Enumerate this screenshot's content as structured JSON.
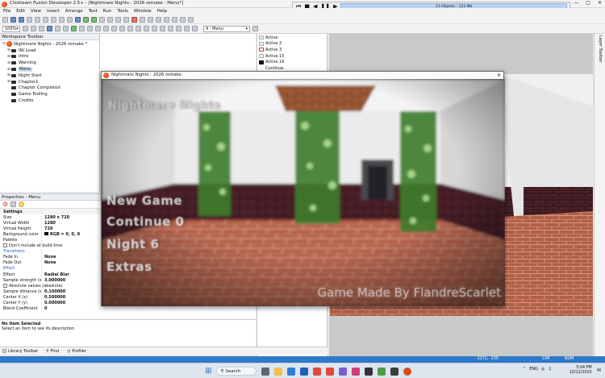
{
  "app": {
    "title": "Clickteam Fusion Developer 2.5+ - [Nightmare Nights - 2026 remake - Menu*]",
    "menus": [
      "File",
      "Edit",
      "View",
      "Insert",
      "Arrange",
      "Text",
      "Run",
      "Tools",
      "Window",
      "Help"
    ],
    "zoom": "100%",
    "frame_select": "4 - Menu"
  },
  "runbar": {
    "status": "23 Objects - 123 Mb"
  },
  "workspace": {
    "title": "Workspace Toolbar",
    "project": "Nightmare Nights - 2026 remake *",
    "frames": [
      "INI Load",
      "Intro",
      "Warning",
      "Menu",
      "Night Start",
      "Chapter1",
      "Chapter Completed",
      "Game Ending",
      "Credits"
    ]
  },
  "event_list": {
    "items": [
      "Active",
      "Active 2",
      "Active 3",
      "Active 15",
      "Active 16",
      "Continue"
    ]
  },
  "layers_tab": "Layer Toolbar",
  "properties": {
    "title": "Properties - Menu",
    "rows": [
      {
        "k": "Settings",
        "v": "",
        "type": "sec"
      },
      {
        "k": "Size",
        "v": "1280 x 720"
      },
      {
        "k": "Virtual Width",
        "v": "1280"
      },
      {
        "k": "Virtual Height",
        "v": "720"
      },
      {
        "k": "Background color",
        "v": "RGB = 0, 0, 0",
        "swatch": true
      },
      {
        "k": "Palette",
        "v": ""
      },
      {
        "k": "Don't include at build time",
        "v": "",
        "check": true,
        "wide": true
      },
      {
        "k": "Transitions",
        "v": "",
        "type": "blue"
      },
      {
        "k": "Fade In",
        "v": "None"
      },
      {
        "k": "Fade Out",
        "v": "None"
      },
      {
        "k": "Effect",
        "v": "",
        "type": "blue"
      },
      {
        "k": "Effect",
        "v": "Radial Blur"
      },
      {
        "k": "Sample strength (sam...",
        "v": "3.000000"
      },
      {
        "k": "Absolute values (absolute)",
        "v": "",
        "check": true,
        "wide": true
      },
      {
        "k": "Sample distance (sam...",
        "v": "0.100000"
      },
      {
        "k": "Center X (x)",
        "v": "0.500000"
      },
      {
        "k": "Center Y (y)",
        "v": "0.000000"
      },
      {
        "k": "Blend Coefficient",
        "v": "0"
      }
    ],
    "no_item_title": "No Item Selected",
    "no_item_desc": "Select an item to see its description"
  },
  "bottom_tabs": [
    "Library Toolbar",
    "Find",
    "Profiler"
  ],
  "statusbar": {
    "coords": "-1272, -235",
    "caps": "CAP",
    "num": "NUM"
  },
  "game_window": {
    "title": "Nightmare Nights - 2026 remake",
    "logo_text": "Nightmare Nights",
    "menu": [
      "New Game",
      "Continue 0",
      "Night 6",
      "Extras"
    ],
    "credit": "Game Made By FlandreScarlet"
  },
  "taskbar": {
    "search": "Search",
    "lang": "ENG",
    "time": "5:04 PM",
    "date": "10/12/2025"
  },
  "colors": {
    "accent": "#2e79c9",
    "brick": "#4a2228",
    "floor": "#b36048"
  }
}
